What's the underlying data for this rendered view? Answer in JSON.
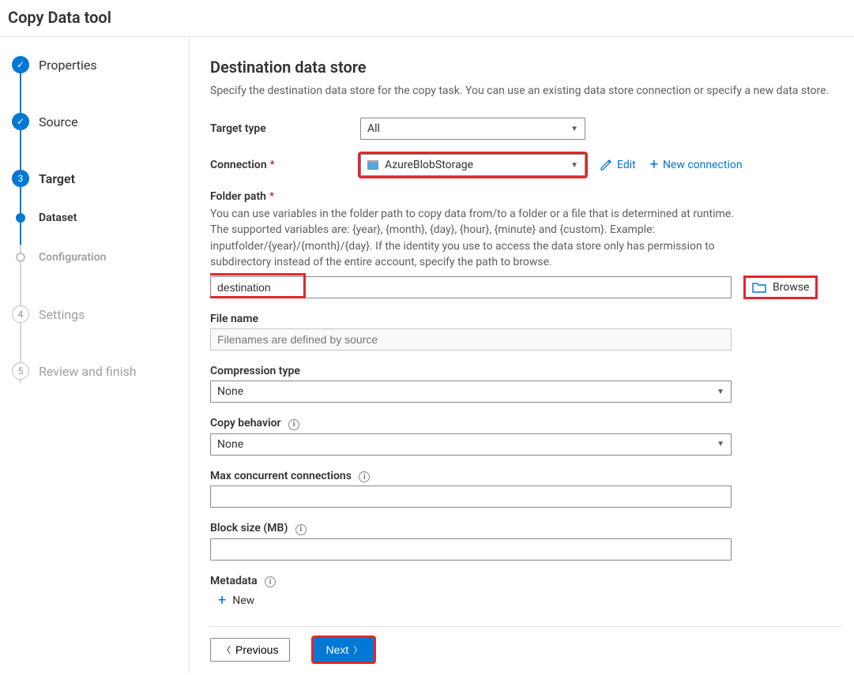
{
  "app_title": "Copy Data tool",
  "sidebar": {
    "steps": [
      {
        "label": "Properties"
      },
      {
        "label": "Source"
      },
      {
        "label": "Target",
        "num": "3"
      },
      {
        "label": "Dataset"
      },
      {
        "label": "Configuration"
      },
      {
        "label": "Settings",
        "num": "4"
      },
      {
        "label": "Review and finish",
        "num": "5"
      }
    ]
  },
  "page": {
    "title": "Destination data store",
    "desc": "Specify the destination data store for the copy task. You can use an existing data store connection or specify a new data store."
  },
  "fields": {
    "target_type_label": "Target type",
    "target_type_value": "All",
    "connection_label": "Connection",
    "connection_value": "AzureBlobStorage",
    "edit_label": "Edit",
    "new_connection_label": "New connection",
    "folder_path_label": "Folder path",
    "folder_path_help": "You can use variables in the folder path to copy data from/to a folder or a file that is determined at runtime. The supported variables are: {year}, {month}, {day}, {hour}, {minute} and {custom}. Example: inputfolder/{year}/{month}/{day}. If the identity you use to access the data store only has permission to subdirectory instead of the entire account, specify the path to browse.",
    "folder_path_value": "destination",
    "browse_label": "Browse",
    "file_name_label": "File name",
    "file_name_placeholder": "Filenames are defined by source",
    "compression_label": "Compression type",
    "compression_value": "None",
    "copy_behavior_label": "Copy behavior",
    "copy_behavior_value": "None",
    "max_conn_label": "Max concurrent connections",
    "block_size_label": "Block size (MB)",
    "metadata_label": "Metadata",
    "metadata_new": "New"
  },
  "footer": {
    "previous": "Previous",
    "next": "Next"
  }
}
